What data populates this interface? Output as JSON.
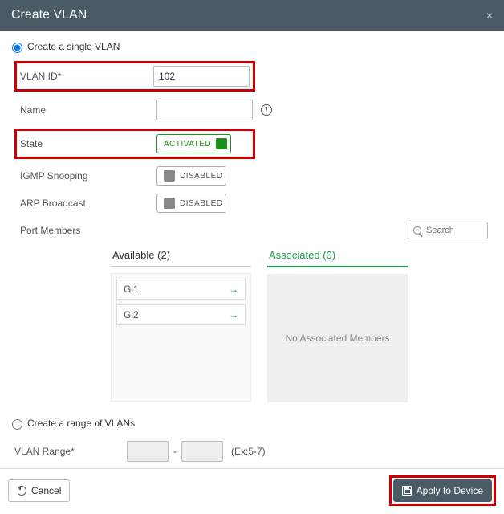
{
  "header": {
    "title": "Create VLAN",
    "close": "×"
  },
  "mode": {
    "single_label": "Create a single VLAN",
    "range_label": "Create a range of VLANs",
    "selected": "single"
  },
  "form": {
    "vlan_id": {
      "label": "VLAN ID*",
      "value": "102"
    },
    "name": {
      "label": "Name",
      "value": ""
    },
    "state": {
      "label": "State",
      "value": "ACTIVATED",
      "on": true
    },
    "igmp": {
      "label": "IGMP Snooping",
      "value": "DISABLED",
      "on": false
    },
    "arp": {
      "label": "ARP Broadcast",
      "value": "DISABLED",
      "on": false
    },
    "port_members_label": "Port Members",
    "search_placeholder": "Search"
  },
  "lists": {
    "available": {
      "title": "Available (2)",
      "items": [
        {
          "label": "Gi1"
        },
        {
          "label": "Gi2"
        }
      ]
    },
    "associated": {
      "title": "Associated (0)",
      "empty_text": "No Associated Members"
    }
  },
  "range": {
    "label": "VLAN Range*",
    "from": "",
    "to": "",
    "hint": "(Ex:5-7)"
  },
  "footer": {
    "cancel": "Cancel",
    "apply": "Apply to Device"
  }
}
